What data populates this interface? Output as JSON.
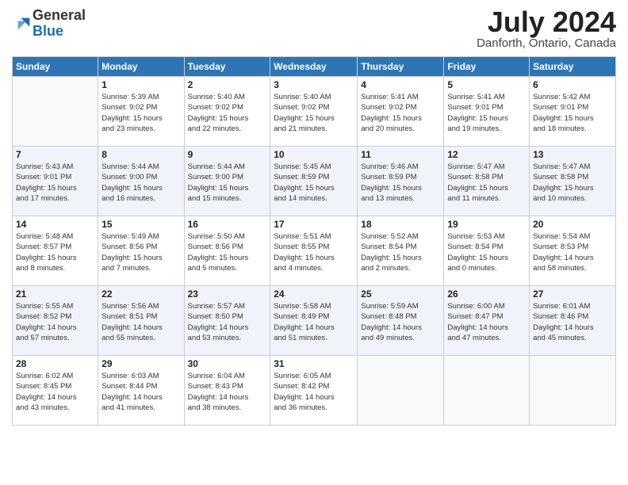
{
  "logo": {
    "general": "General",
    "blue": "Blue"
  },
  "header": {
    "month_year": "July 2024",
    "location": "Danforth, Ontario, Canada"
  },
  "days_of_week": [
    "Sunday",
    "Monday",
    "Tuesday",
    "Wednesday",
    "Thursday",
    "Friday",
    "Saturday"
  ],
  "weeks": [
    [
      {
        "day": "",
        "info": ""
      },
      {
        "day": "1",
        "info": "Sunrise: 5:39 AM\nSunset: 9:02 PM\nDaylight: 15 hours\nand 23 minutes."
      },
      {
        "day": "2",
        "info": "Sunrise: 5:40 AM\nSunset: 9:02 PM\nDaylight: 15 hours\nand 22 minutes."
      },
      {
        "day": "3",
        "info": "Sunrise: 5:40 AM\nSunset: 9:02 PM\nDaylight: 15 hours\nand 21 minutes."
      },
      {
        "day": "4",
        "info": "Sunrise: 5:41 AM\nSunset: 9:02 PM\nDaylight: 15 hours\nand 20 minutes."
      },
      {
        "day": "5",
        "info": "Sunrise: 5:41 AM\nSunset: 9:01 PM\nDaylight: 15 hours\nand 19 minutes."
      },
      {
        "day": "6",
        "info": "Sunrise: 5:42 AM\nSunset: 9:01 PM\nDaylight: 15 hours\nand 18 minutes."
      }
    ],
    [
      {
        "day": "7",
        "info": "Sunrise: 5:43 AM\nSunset: 9:01 PM\nDaylight: 15 hours\nand 17 minutes."
      },
      {
        "day": "8",
        "info": "Sunrise: 5:44 AM\nSunset: 9:00 PM\nDaylight: 15 hours\nand 16 minutes."
      },
      {
        "day": "9",
        "info": "Sunrise: 5:44 AM\nSunset: 9:00 PM\nDaylight: 15 hours\nand 15 minutes."
      },
      {
        "day": "10",
        "info": "Sunrise: 5:45 AM\nSunset: 8:59 PM\nDaylight: 15 hours\nand 14 minutes."
      },
      {
        "day": "11",
        "info": "Sunrise: 5:46 AM\nSunset: 8:59 PM\nDaylight: 15 hours\nand 13 minutes."
      },
      {
        "day": "12",
        "info": "Sunrise: 5:47 AM\nSunset: 8:58 PM\nDaylight: 15 hours\nand 11 minutes."
      },
      {
        "day": "13",
        "info": "Sunrise: 5:47 AM\nSunset: 8:58 PM\nDaylight: 15 hours\nand 10 minutes."
      }
    ],
    [
      {
        "day": "14",
        "info": "Sunrise: 5:48 AM\nSunset: 8:57 PM\nDaylight: 15 hours\nand 8 minutes."
      },
      {
        "day": "15",
        "info": "Sunrise: 5:49 AM\nSunset: 8:56 PM\nDaylight: 15 hours\nand 7 minutes."
      },
      {
        "day": "16",
        "info": "Sunrise: 5:50 AM\nSunset: 8:56 PM\nDaylight: 15 hours\nand 5 minutes."
      },
      {
        "day": "17",
        "info": "Sunrise: 5:51 AM\nSunset: 8:55 PM\nDaylight: 15 hours\nand 4 minutes."
      },
      {
        "day": "18",
        "info": "Sunrise: 5:52 AM\nSunset: 8:54 PM\nDaylight: 15 hours\nand 2 minutes."
      },
      {
        "day": "19",
        "info": "Sunrise: 5:53 AM\nSunset: 8:54 PM\nDaylight: 15 hours\nand 0 minutes."
      },
      {
        "day": "20",
        "info": "Sunrise: 5:54 AM\nSunset: 8:53 PM\nDaylight: 14 hours\nand 58 minutes."
      }
    ],
    [
      {
        "day": "21",
        "info": "Sunrise: 5:55 AM\nSunset: 8:52 PM\nDaylight: 14 hours\nand 57 minutes."
      },
      {
        "day": "22",
        "info": "Sunrise: 5:56 AM\nSunset: 8:51 PM\nDaylight: 14 hours\nand 55 minutes."
      },
      {
        "day": "23",
        "info": "Sunrise: 5:57 AM\nSunset: 8:50 PM\nDaylight: 14 hours\nand 53 minutes."
      },
      {
        "day": "24",
        "info": "Sunrise: 5:58 AM\nSunset: 8:49 PM\nDaylight: 14 hours\nand 51 minutes."
      },
      {
        "day": "25",
        "info": "Sunrise: 5:59 AM\nSunset: 8:48 PM\nDaylight: 14 hours\nand 49 minutes."
      },
      {
        "day": "26",
        "info": "Sunrise: 6:00 AM\nSunset: 8:47 PM\nDaylight: 14 hours\nand 47 minutes."
      },
      {
        "day": "27",
        "info": "Sunrise: 6:01 AM\nSunset: 8:46 PM\nDaylight: 14 hours\nand 45 minutes."
      }
    ],
    [
      {
        "day": "28",
        "info": "Sunrise: 6:02 AM\nSunset: 8:45 PM\nDaylight: 14 hours\nand 43 minutes."
      },
      {
        "day": "29",
        "info": "Sunrise: 6:03 AM\nSunset: 8:44 PM\nDaylight: 14 hours\nand 41 minutes."
      },
      {
        "day": "30",
        "info": "Sunrise: 6:04 AM\nSunset: 8:43 PM\nDaylight: 14 hours\nand 38 minutes."
      },
      {
        "day": "31",
        "info": "Sunrise: 6:05 AM\nSunset: 8:42 PM\nDaylight: 14 hours\nand 36 minutes."
      },
      {
        "day": "",
        "info": ""
      },
      {
        "day": "",
        "info": ""
      },
      {
        "day": "",
        "info": ""
      }
    ]
  ]
}
